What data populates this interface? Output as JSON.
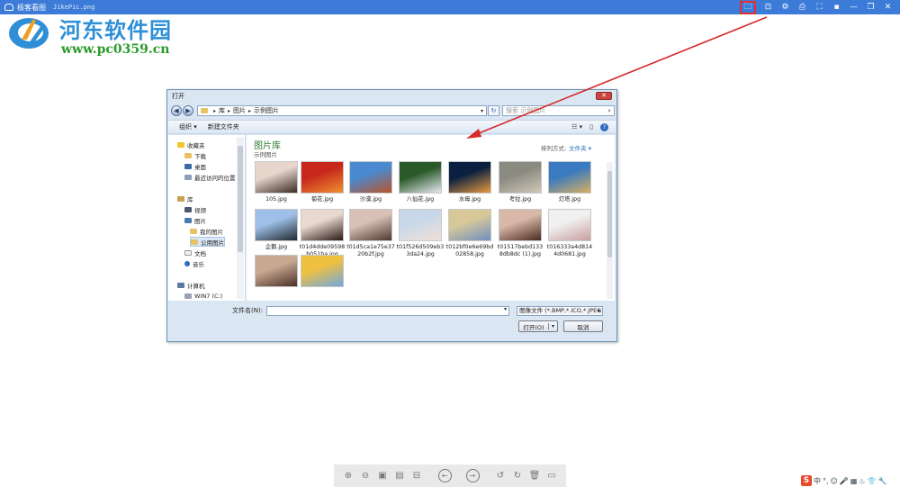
{
  "app": {
    "name": "极客看图",
    "file": "JikePic.png",
    "window_icons": [
      {
        "name": "open-folder-icon",
        "glyph": "🗀",
        "active": true
      },
      {
        "name": "crop-icon",
        "glyph": "⊡",
        "active": false
      },
      {
        "name": "settings-icon",
        "glyph": "⚙",
        "active": false
      },
      {
        "name": "print-icon",
        "glyph": "⎙",
        "active": false
      },
      {
        "name": "fullscreen-icon",
        "glyph": "⛶",
        "active": false
      },
      {
        "name": "pin-icon",
        "glyph": "▪",
        "active": false
      },
      {
        "name": "minimize-icon",
        "glyph": "—",
        "active": false
      },
      {
        "name": "restore-icon",
        "glyph": "❐",
        "active": false
      },
      {
        "name": "close-icon",
        "glyph": "✕",
        "active": false
      }
    ]
  },
  "watermark": {
    "site": "河东软件园",
    "url": "www.pc0359.cn"
  },
  "dialog": {
    "title": "打开",
    "close": "✕",
    "breadcrumb": [
      "库",
      "图片",
      "示例图片"
    ],
    "search_placeholder": "搜索 示例图片",
    "toolbar": {
      "organize": "组织 ▾",
      "new_folder": "新建文件夹"
    },
    "nav": {
      "favorites": "收藏夹",
      "download": "下载",
      "desktop": "桌面",
      "recent": "最近访问的位置",
      "libraries": "库",
      "video": "视频",
      "pictures": "图片",
      "my_pictures": "我的图片",
      "public_pictures": "公用图片",
      "documents": "文档",
      "music": "音乐",
      "computer": "计算机",
      "drive": "WIN7 (C:)"
    },
    "library_title": "图片库",
    "library_sub": "示例图片",
    "arrange_label": "排列方式:",
    "arrange_value": "文件夹 ▾",
    "files": [
      {
        "name": "105.jpg",
        "colors": [
          "#e6d6cc",
          "#3a2a24"
        ]
      },
      {
        "name": "菊花.jpg",
        "colors": [
          "#c8281c",
          "#f09030"
        ]
      },
      {
        "name": "沙漠.jpg",
        "colors": [
          "#4a8ad0",
          "#b8542a"
        ]
      },
      {
        "name": "八仙花.jpg",
        "colors": [
          "#2a5a2a",
          "#e8e8f0"
        ]
      },
      {
        "name": "水母.jpg",
        "colors": [
          "#0a2040",
          "#e89a40"
        ]
      },
      {
        "name": "考拉.jpg",
        "colors": [
          "#8a8a80",
          "#cfc8b8"
        ]
      },
      {
        "name": "灯塔.jpg",
        "colors": [
          "#3a7ac0",
          "#d8b060"
        ]
      },
      {
        "name": "企鹅.jpg",
        "colors": [
          "#9ec0e8",
          "#202830"
        ]
      },
      {
        "name": "t01d4dde09598b051ba.jpg",
        "colors": [
          "#e8d8d0",
          "#2a1a14"
        ]
      },
      {
        "name": "t01d5ca1e75e3720b2f.jpg",
        "colors": [
          "#d8c0b8",
          "#503830"
        ]
      },
      {
        "name": "t01f526d509eb33da24.jpg",
        "colors": [
          "#c8d8e8",
          "#f0e0d8"
        ]
      },
      {
        "name": "t012bf0e6e69bd02858.jpg",
        "colors": [
          "#d8c898",
          "#7090c0"
        ]
      },
      {
        "name": "t01517bebd1338db8dc (1).jpg",
        "colors": [
          "#d8b8a8",
          "#4a2a20"
        ]
      },
      {
        "name": "t016333a4d8144d0681.jpg",
        "colors": [
          "#f0f0f0",
          "#c8a0a0"
        ]
      },
      {
        "name": "",
        "colors": [
          "#c8a890",
          "#4a3028"
        ]
      },
      {
        "name": "",
        "colors": [
          "#f0c040",
          "#70a8e0"
        ]
      }
    ],
    "filename_label": "文件名(N):",
    "filename_value": "",
    "filter": "图像文件 (*.BMP,*.ICO,*.JPEG",
    "open_label": "打开(O)",
    "cancel_label": "取消"
  },
  "bottom_toolbar": [
    {
      "name": "zoom-in-icon",
      "glyph": "⊕",
      "circle": false
    },
    {
      "name": "zoom-out-icon",
      "glyph": "⊖",
      "circle": false
    },
    {
      "name": "fit-window-icon",
      "glyph": "▣",
      "circle": false
    },
    {
      "name": "actual-size-icon",
      "glyph": "▤",
      "circle": false
    },
    {
      "name": "slideshow-icon",
      "glyph": "⊟",
      "circle": false
    },
    {
      "name": "gap",
      "glyph": "",
      "circle": false
    },
    {
      "name": "previous-icon",
      "glyph": "←",
      "circle": true
    },
    {
      "name": "gap",
      "glyph": "",
      "circle": false
    },
    {
      "name": "next-icon",
      "glyph": "→",
      "circle": true
    },
    {
      "name": "gap",
      "glyph": "",
      "circle": false
    },
    {
      "name": "rotate-left-icon",
      "glyph": "↺",
      "circle": false
    },
    {
      "name": "rotate-right-icon",
      "glyph": "↻",
      "circle": false
    },
    {
      "name": "delete-icon",
      "glyph": "🗑",
      "circle": false
    },
    {
      "name": "save-icon",
      "glyph": "▭",
      "circle": false
    }
  ],
  "ime": {
    "logo": "S",
    "items": [
      "中",
      "°,",
      "☺",
      "🎤",
      "▦",
      "♨",
      "👕",
      "🔧"
    ]
  },
  "colors": {
    "titlebar": "#3c7bd8",
    "highlight_box": "#e03030",
    "arrow": "#d62a2a"
  }
}
